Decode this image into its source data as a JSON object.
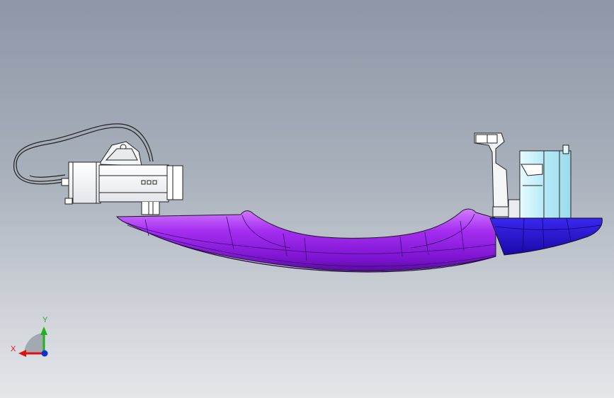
{
  "triad": {
    "x_label": "X",
    "y_label": "Y"
  },
  "colors": {
    "handle_body": "#9a1ee6",
    "handle_highlight": "#c66bff",
    "handle_shadow": "#5a0ca0",
    "end_cap": "#2a10e0",
    "housing": "#b8ecf7",
    "connector_body": "#ffffff",
    "outline": "#1a1a1a",
    "x_axis": "#e01010",
    "y_axis": "#20b020",
    "z_axis": "#1030d0"
  }
}
